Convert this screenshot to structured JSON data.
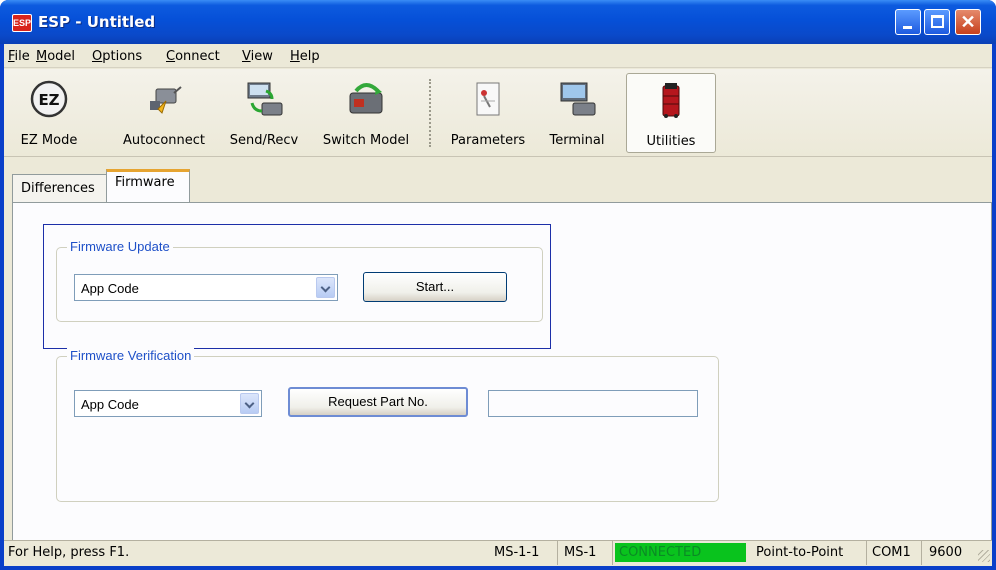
{
  "window": {
    "title": "ESP - Untitled",
    "app_icon_text": "ESP",
    "close_glyph": "✕"
  },
  "menubar": {
    "items": [
      {
        "label": "File",
        "mnemonic": "F",
        "rest": "ile"
      },
      {
        "label": "Model",
        "mnemonic": "M",
        "rest": "odel"
      },
      {
        "label": "Options",
        "mnemonic": "O",
        "rest": "ptions"
      },
      {
        "label": "Connect",
        "mnemonic": "C",
        "rest": "onnect"
      },
      {
        "label": "View",
        "mnemonic": "V",
        "rest": "iew"
      },
      {
        "label": "Help",
        "mnemonic": "H",
        "rest": "elp"
      }
    ]
  },
  "toolbar": {
    "buttons": [
      {
        "label": "EZ Mode",
        "icon": "ez-mode-icon"
      },
      {
        "label": "Autoconnect",
        "icon": "autoconnect-icon"
      },
      {
        "label": "Send/Recv",
        "icon": "send-recv-icon"
      },
      {
        "label": "Switch Model",
        "icon": "switch-model-icon"
      },
      {
        "label": "Parameters",
        "icon": "parameters-icon"
      },
      {
        "label": "Terminal",
        "icon": "terminal-icon"
      },
      {
        "label": "Utilities",
        "icon": "utilities-icon",
        "active": true
      }
    ],
    "ez_icon_text": "EZ"
  },
  "tabs": {
    "items": [
      {
        "label": "Differences",
        "selected": false
      },
      {
        "label": "Firmware",
        "selected": true
      }
    ]
  },
  "firmware_update": {
    "legend": "Firmware Update",
    "combo_value": "App Code",
    "start_label": "Start..."
  },
  "firmware_verification": {
    "legend": "Firmware Verification",
    "combo_value": "App Code",
    "request_label": "Request Part No.",
    "part_no_value": ""
  },
  "statusbar": {
    "help_text": "For Help, press F1.",
    "model_id": "MS-1-1",
    "model": "MS-1",
    "connection_status": "CONNECTED",
    "mode": "Point-to-Point",
    "port": "COM1",
    "baud": "9600"
  },
  "colors": {
    "titlebar": "#0650d8",
    "connected_bg": "#09c31d",
    "legend_text": "#1e50c8",
    "active_tab_accent": "#e6a431"
  }
}
